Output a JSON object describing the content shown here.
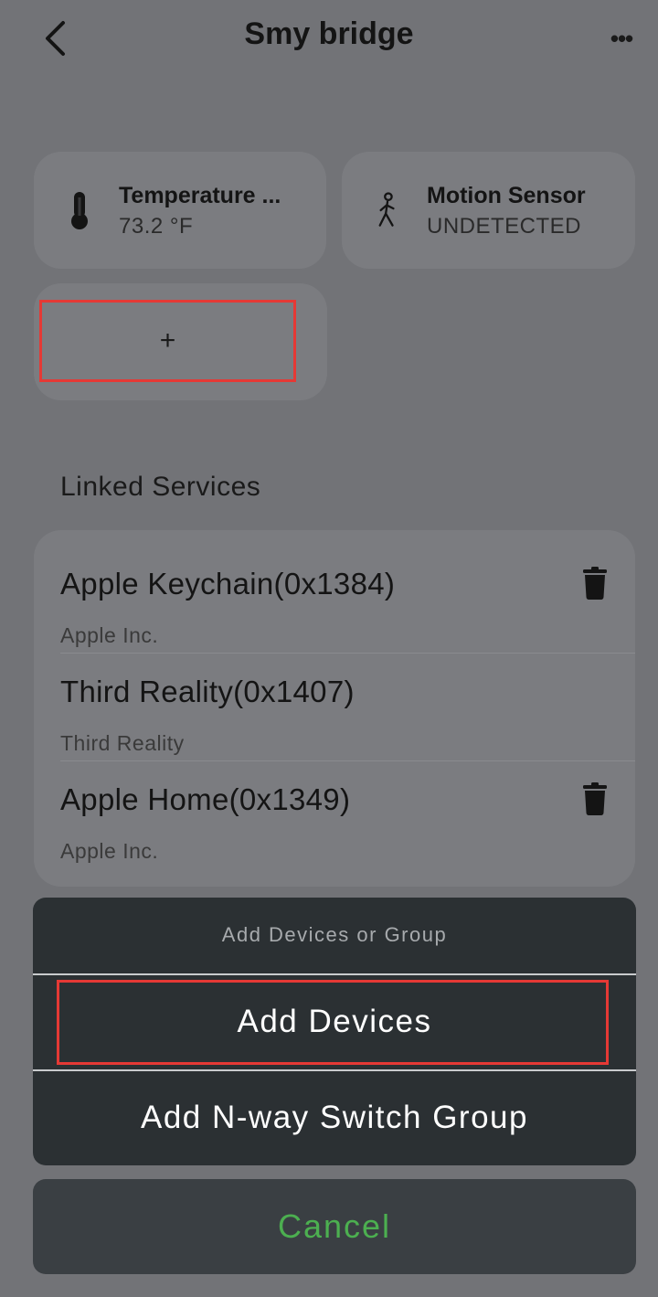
{
  "header": {
    "title": "Smy bridge",
    "back_icon": "chevron-left-icon",
    "more_label": "•••"
  },
  "devices": [
    {
      "name": "Temperature ...",
      "value": "73.2 °F",
      "icon": "thermometer-icon"
    },
    {
      "name": "Motion Sensor",
      "value": "UNDETECTED",
      "icon": "walking-person-icon"
    }
  ],
  "add_card": {
    "label": "+"
  },
  "linked_services": {
    "title": "Linked Services",
    "items": [
      {
        "name": "Apple Keychain(0x1384)",
        "vendor": "Apple Inc.",
        "deletable": true
      },
      {
        "name": "Third Reality(0x1407)",
        "vendor": "Third Reality",
        "deletable": false
      },
      {
        "name": "Apple Home(0x1349)",
        "vendor": "Apple Inc.",
        "deletable": true
      }
    ]
  },
  "action_sheet": {
    "title": "Add Devices or Group",
    "options": [
      "Add Devices",
      "Add N-way Switch Group"
    ],
    "cancel_label": "Cancel"
  },
  "colors": {
    "overlay_background": "#727377",
    "card_background": "#7b7c80",
    "sheet_background": "#2b3033",
    "cancel_text": "#4caf50",
    "highlight_border": "#e53935"
  }
}
